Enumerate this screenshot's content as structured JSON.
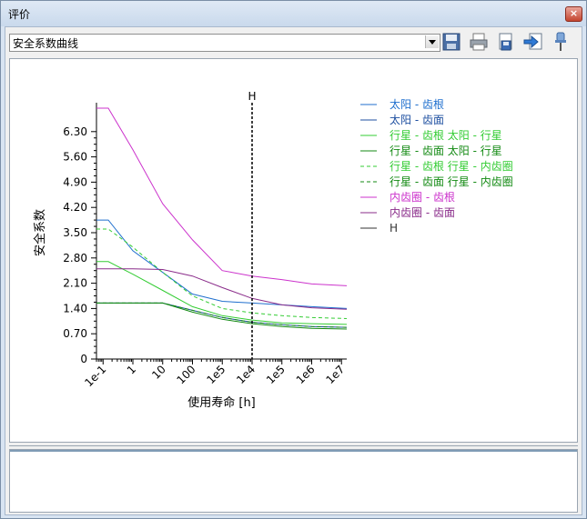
{
  "window": {
    "title": "评价",
    "close_label": "×"
  },
  "toolbar": {
    "combo_value": "安全系数曲线",
    "buttons": [
      {
        "name": "save-button",
        "icon": "floppy-disk-icon"
      },
      {
        "name": "print-button",
        "icon": "printer-icon"
      },
      {
        "name": "export-button",
        "icon": "document-export-icon"
      },
      {
        "name": "import-button",
        "icon": "document-arrow-icon"
      },
      {
        "name": "pin-button",
        "icon": "pin-icon"
      }
    ]
  },
  "chart_data": {
    "type": "line",
    "xlabel": "使用寿命 [h]",
    "ylabel": "安全系数",
    "x_scale": "log",
    "xlim": [
      0.06,
      15000000
    ],
    "ylim": [
      0,
      7
    ],
    "x_ticks": [
      "1e-1",
      "1",
      "10",
      "100",
      "1e5",
      "1e4",
      "1e5",
      "1e6",
      "1e7"
    ],
    "y_ticks": [
      "0",
      "0.70",
      "1.40",
      "2.10",
      "2.80",
      "3.50",
      "4.20",
      "4.90",
      "5.60",
      "6.30"
    ],
    "y_tick_values": [
      0,
      0.7,
      1.4,
      2.1,
      2.8,
      3.5,
      4.2,
      4.9,
      5.6,
      6.3
    ],
    "vline": {
      "label": "H",
      "x": 10000,
      "color": "#000000"
    },
    "series": [
      {
        "name": "太阳 - 齿根",
        "color": "#1f6fce",
        "dash": false,
        "x": [
          0.06,
          0.15,
          1,
          10,
          100,
          1000,
          10000,
          100000,
          1000000,
          15000000
        ],
        "y": [
          3.85,
          3.85,
          3.0,
          2.4,
          1.8,
          1.6,
          1.55,
          1.5,
          1.45,
          1.4
        ]
      },
      {
        "name": "太阳 - 齿面",
        "color": "#1e4fa0",
        "dash": false,
        "x": [
          0.06,
          10,
          100,
          1000,
          10000,
          100000,
          1000000,
          15000000
        ],
        "y": [
          1.55,
          1.55,
          1.35,
          1.15,
          1.02,
          0.95,
          0.9,
          0.88
        ]
      },
      {
        "name": "行星 - 齿根 太阳 - 行星",
        "color": "#33cc33",
        "dash": false,
        "x": [
          0.06,
          0.15,
          1,
          10,
          100,
          1000,
          10000,
          100000,
          1000000,
          15000000
        ],
        "y": [
          2.7,
          2.7,
          2.35,
          1.9,
          1.45,
          1.2,
          1.08,
          1.0,
          0.98,
          0.96
        ]
      },
      {
        "name": "行星 - 齿面 太阳 - 行星",
        "color": "#138a13",
        "dash": false,
        "x": [
          0.06,
          10,
          100,
          1000,
          10000,
          100000,
          1000000,
          15000000
        ],
        "y": [
          1.55,
          1.55,
          1.3,
          1.1,
          0.98,
          0.9,
          0.85,
          0.83
        ]
      },
      {
        "name": "行星 - 齿根 行星 - 内齿圈",
        "color": "#33cc33",
        "dash": true,
        "x": [
          0.06,
          0.15,
          1,
          10,
          100,
          1000,
          10000,
          100000,
          1000000,
          15000000
        ],
        "y": [
          3.6,
          3.6,
          3.1,
          2.4,
          1.75,
          1.4,
          1.28,
          1.2,
          1.15,
          1.12
        ]
      },
      {
        "name": "行星 - 齿面 行星 - 内齿圈",
        "color": "#138a13",
        "dash": true,
        "x": [
          0.06,
          10,
          100,
          1000,
          10000,
          100000,
          1000000,
          15000000
        ],
        "y": [
          1.55,
          1.55,
          1.35,
          1.15,
          1.02,
          0.95,
          0.9,
          0.88
        ]
      },
      {
        "name": "内齿圈 - 齿根",
        "color": "#cc33cc",
        "dash": false,
        "x": [
          0.06,
          0.15,
          1,
          10,
          100,
          1000,
          10000,
          100000,
          1000000,
          15000000
        ],
        "y": [
          6.95,
          6.95,
          5.8,
          4.3,
          3.3,
          2.45,
          2.3,
          2.2,
          2.08,
          2.03
        ]
      },
      {
        "name": "内齿圈 - 齿面",
        "color": "#8a2c8a",
        "dash": false,
        "x": [
          0.06,
          1,
          10,
          100,
          1000,
          10000,
          100000,
          1000000,
          15000000
        ],
        "y": [
          2.5,
          2.5,
          2.48,
          2.3,
          1.98,
          1.68,
          1.5,
          1.42,
          1.38
        ]
      },
      {
        "name": "H",
        "color": "#333333",
        "dash": false,
        "x": [],
        "y": []
      }
    ]
  }
}
